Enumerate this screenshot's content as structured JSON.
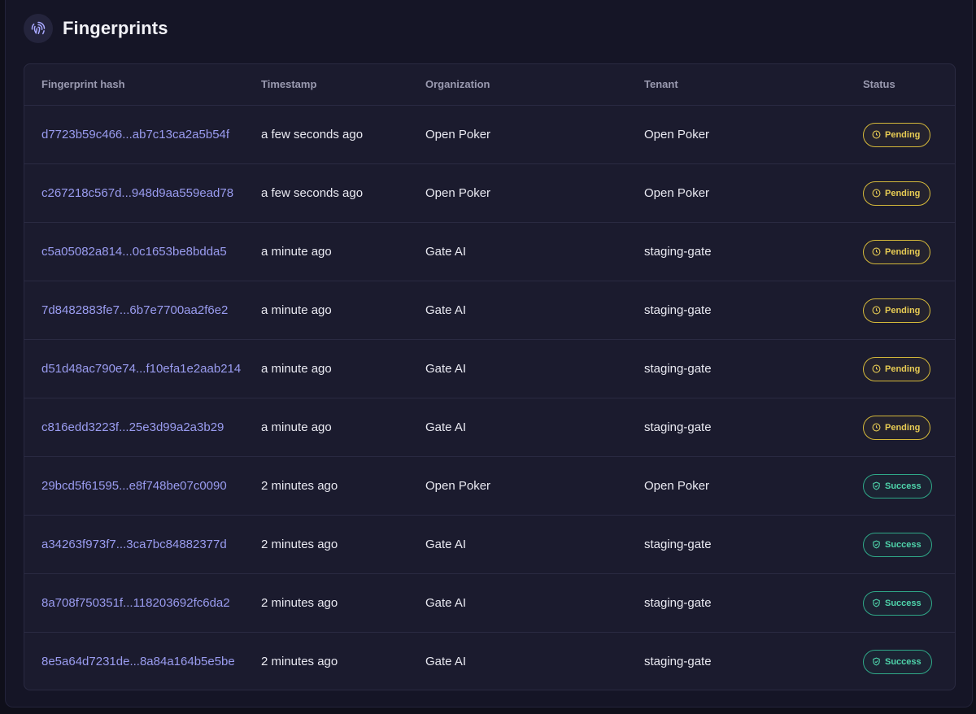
{
  "page": {
    "title": "Fingerprints",
    "icon": "fingerprint-icon"
  },
  "table": {
    "columns": [
      "Fingerprint hash",
      "Timestamp",
      "Organization",
      "Tenant",
      "Status"
    ],
    "rows": [
      {
        "hash": "d7723b59c466...ab7c13ca2a5b54f",
        "timestamp": "a few seconds ago",
        "organization": "Open Poker",
        "tenant": "Open Poker",
        "status": "Pending"
      },
      {
        "hash": "c267218c567d...948d9aa559ead78",
        "timestamp": "a few seconds ago",
        "organization": "Open Poker",
        "tenant": "Open Poker",
        "status": "Pending"
      },
      {
        "hash": "c5a05082a814...0c1653be8bdda5",
        "timestamp": "a minute ago",
        "organization": "Gate AI",
        "tenant": "staging-gate",
        "status": "Pending"
      },
      {
        "hash": "7d8482883fe7...6b7e7700aa2f6e2",
        "timestamp": "a minute ago",
        "organization": "Gate AI",
        "tenant": "staging-gate",
        "status": "Pending"
      },
      {
        "hash": "d51d48ac790e74...f10efa1e2aab214",
        "timestamp": "a minute ago",
        "organization": "Gate AI",
        "tenant": "staging-gate",
        "status": "Pending"
      },
      {
        "hash": "c816edd3223f...25e3d99a2a3b29",
        "timestamp": "a minute ago",
        "organization": "Gate AI",
        "tenant": "staging-gate",
        "status": "Pending"
      },
      {
        "hash": "29bcd5f61595...e8f748be07c0090",
        "timestamp": "2 minutes ago",
        "organization": "Open Poker",
        "tenant": "Open Poker",
        "status": "Success"
      },
      {
        "hash": "a34263f973f7...3ca7bc84882377d",
        "timestamp": "2 minutes ago",
        "organization": "Gate AI",
        "tenant": "staging-gate",
        "status": "Success"
      },
      {
        "hash": "8a708f750351f...118203692fc6da2",
        "timestamp": "2 minutes ago",
        "organization": "Gate AI",
        "tenant": "staging-gate",
        "status": "Success"
      },
      {
        "hash": "8e5a64d7231de...8a84a164b5e5be",
        "timestamp": "2 minutes ago",
        "organization": "Gate AI",
        "tenant": "staging-gate",
        "status": "Success"
      }
    ]
  },
  "colors": {
    "background": "#0f0f1a",
    "card": "#151526",
    "table": "#1b1b2e",
    "hash_link": "#9a9cf0",
    "pending": "#e8cc54",
    "success": "#4fd4ab"
  },
  "icons": {
    "pending": "clock-icon",
    "success": "shield-check-icon"
  }
}
